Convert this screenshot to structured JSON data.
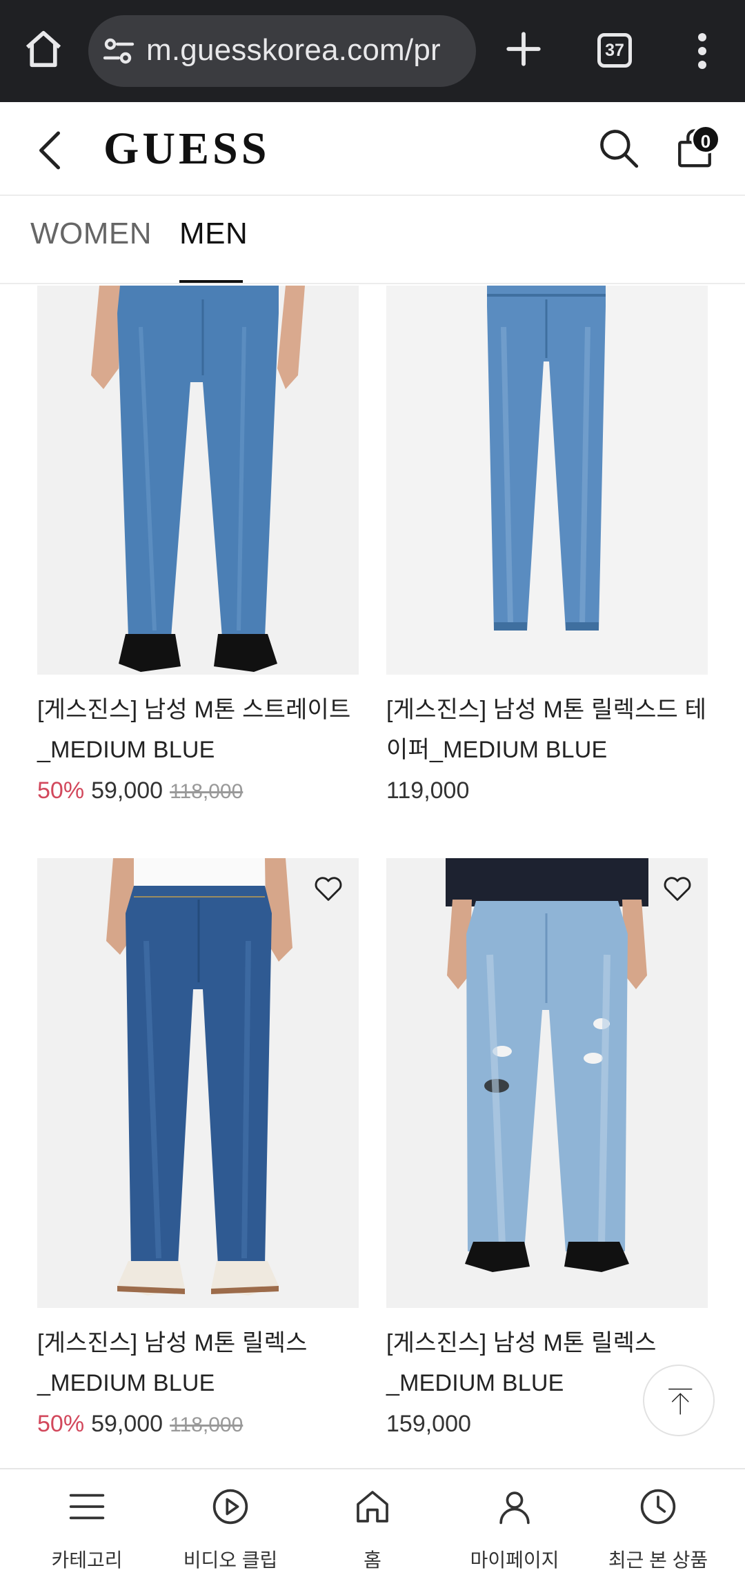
{
  "browser": {
    "url": "m.guesskorea.com/pr",
    "tab_count": "37"
  },
  "header": {
    "logo": "GUESS",
    "cart_count": "0"
  },
  "gender_tabs": {
    "women": "WOMEN",
    "men": "MEN",
    "active": "men"
  },
  "products": [
    {
      "line1": "[게스진스] 남성 M톤 스트레이트",
      "line2": "_MEDIUM BLUE",
      "discount": "50%",
      "price": "59,000",
      "original": "118,000",
      "wishlist": false
    },
    {
      "line1": "[게스진스] 남성 M톤 릴렉스드 테",
      "line2": "이퍼_MEDIUM BLUE",
      "discount": "",
      "price": "119,000",
      "original": "",
      "wishlist": false
    },
    {
      "line1": "[게스진스] 남성 M톤 릴렉스",
      "line2": "_MEDIUM BLUE",
      "discount": "50%",
      "price": "59,000",
      "original": "118,000",
      "wishlist": true
    },
    {
      "line1": "[게스진스] 남성 M톤 릴렉스",
      "line2": "_MEDIUM BLUE",
      "discount": "",
      "price": "159,000",
      "original": "",
      "wishlist": true
    }
  ],
  "bottom_nav": [
    {
      "label": "카테고리",
      "icon": "menu-icon"
    },
    {
      "label": "비디오 클립",
      "icon": "play-circle-icon"
    },
    {
      "label": "홈",
      "icon": "home-icon"
    },
    {
      "label": "마이페이지",
      "icon": "user-icon"
    },
    {
      "label": "최근 본 상품",
      "icon": "clock-icon"
    }
  ],
  "colors": {
    "discount": "#d2485c",
    "browser_bar": "#1f2023",
    "denim_medium": "#4b7fb5",
    "denim_dark": "#2f5a92",
    "denim_light": "#8fb4d6"
  }
}
